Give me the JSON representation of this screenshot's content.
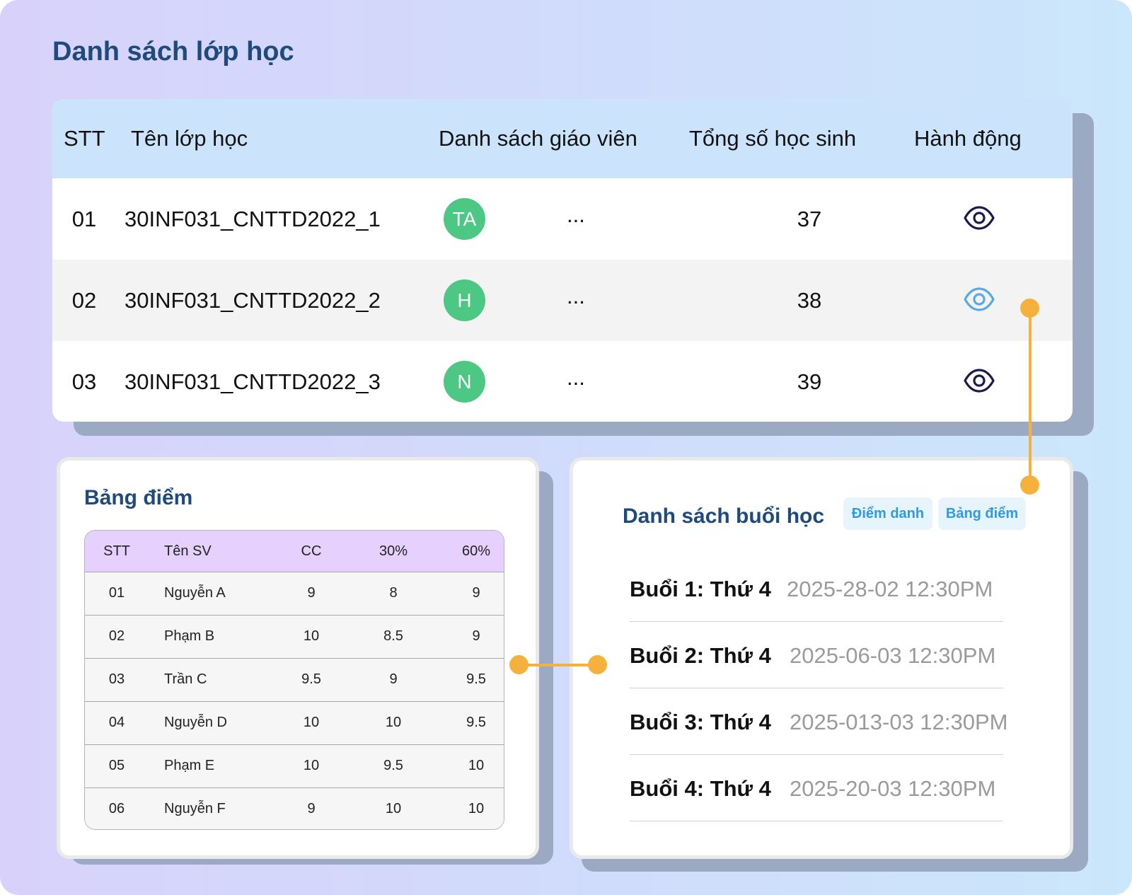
{
  "page": {
    "title": "Danh sách lớp học"
  },
  "class_table": {
    "columns": {
      "stt": "STT",
      "name": "Tên lớp học",
      "teachers": "Danh sách giáo viên",
      "total": "Tổng số học sinh",
      "action": "Hành động"
    },
    "rows": [
      {
        "stt": "01",
        "name": "30INF031_CNTTD2022_1",
        "teacher_initials": "TA",
        "more": "...",
        "total": "37",
        "action_icon": "eye-icon",
        "icon_color": "#1b1a4d"
      },
      {
        "stt": "02",
        "name": "30INF031_CNTTD2022_2",
        "teacher_initials": "H",
        "more": "...",
        "total": "38",
        "action_icon": "eye-icon",
        "icon_color": "#5aa8e8"
      },
      {
        "stt": "03",
        "name": "30INF031_CNTTD2022_3",
        "teacher_initials": "N",
        "more": "...",
        "total": "39",
        "action_icon": "eye-icon",
        "icon_color": "#1b1a4d"
      }
    ]
  },
  "grades": {
    "title": "Bảng điểm",
    "columns": {
      "stt": "STT",
      "name": "Tên SV",
      "cc": "CC",
      "p30": "30%",
      "p60": "60%"
    },
    "rows": [
      {
        "stt": "01",
        "name": "Nguyễn A",
        "cc": "9",
        "p30": "8",
        "p60": "9"
      },
      {
        "stt": "02",
        "name": "Phạm B",
        "cc": "10",
        "p30": "8.5",
        "p60": "9"
      },
      {
        "stt": "03",
        "name": "Trần C",
        "cc": "9.5",
        "p30": "9",
        "p60": "9.5"
      },
      {
        "stt": "04",
        "name": "Nguyễn D",
        "cc": "10",
        "p30": "10",
        "p60": "9.5"
      },
      {
        "stt": "05",
        "name": "Phạm E",
        "cc": "10",
        "p30": "9.5",
        "p60": "10"
      },
      {
        "stt": "06",
        "name": "Nguyễn F",
        "cc": "9",
        "p30": "10",
        "p60": "10"
      }
    ]
  },
  "sessions": {
    "title": "Danh sách buổi học",
    "tabs": {
      "attendance": "Điểm danh",
      "grades": "Bảng điểm"
    },
    "items": [
      {
        "label": "Buổi 1: Thứ 4",
        "date": "2025-28-02 12:30PM"
      },
      {
        "label": "Buổi 2: Thứ 4",
        "date": "2025-06-03 12:30PM"
      },
      {
        "label": "Buổi 3: Thứ 4",
        "date": "2025-013-03 12:30PM"
      },
      {
        "label": "Buổi 4: Thứ 4",
        "date": "2025-20-03 12:30PM"
      }
    ]
  },
  "colors": {
    "title": "#1f4a7c",
    "avatar": "#4cc784",
    "connector": "#f6b13c",
    "tab_text": "#2e9be0",
    "class_header_bg": "#cbe4fc",
    "grade_header_bg": "#e6d0fd"
  }
}
